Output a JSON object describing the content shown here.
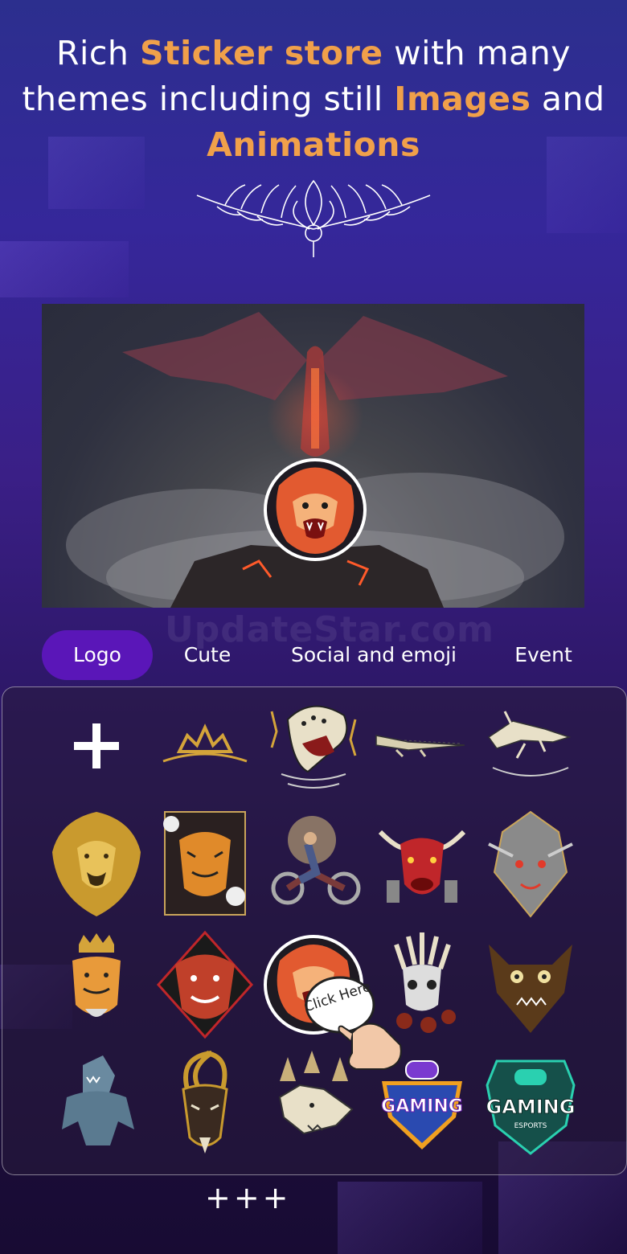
{
  "headline": {
    "line1_a": "Rich ",
    "line1_hl": "Sticker store",
    "line1_b": " with many",
    "line2_a": "themes including still ",
    "line2_hl": "Images",
    "line2_b": " and",
    "line3_hl": "Animations"
  },
  "watermark": "UpdateStar.com",
  "tabs": [
    {
      "label": "Logo",
      "active": true
    },
    {
      "label": "Cute",
      "active": false
    },
    {
      "label": "Social and emoji",
      "active": false
    },
    {
      "label": "Event",
      "active": false
    }
  ],
  "stickers": {
    "row1": [
      "add-icon",
      "crown-sticker",
      "leopard-roar-sticker",
      "crocodile-sticker",
      "crocodile-logo-sticker"
    ],
    "row2": [
      "gold-lion-sticker",
      "tiger-flower-sticker",
      "biker-sticker",
      "red-bull-sticker",
      "mecha-wolf-sticker"
    ],
    "row3": [
      "crowned-tiger-sticker",
      "red-tiger-sticker",
      "lion-mascot-sticker",
      "native-skull-sticker",
      "bat-monster-sticker"
    ],
    "row4": [
      "shark-muscle-sticker",
      "goat-sticker",
      "wolf-forest-sticker",
      "gaming-badge-sticker",
      "gaming-esports-sticker"
    ]
  },
  "gaming_badge_text": "GAMING",
  "gaming_esports_text": "GAMING",
  "gaming_esports_sub": "ESPORTS",
  "click_here": "Click Here",
  "more_label": "+++",
  "colors": {
    "accent": "#f0a04a",
    "tab_active": "#5a16b8"
  }
}
